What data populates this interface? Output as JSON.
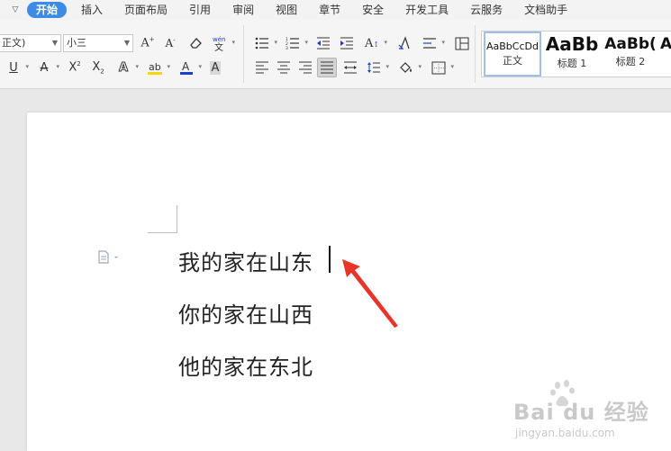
{
  "menu": {
    "items": [
      "开始",
      "插入",
      "页面布局",
      "引用",
      "审阅",
      "视图",
      "章节",
      "安全",
      "开发工具",
      "云服务",
      "文档助手"
    ],
    "active_index": 0
  },
  "ribbon": {
    "font_name": "正文)",
    "font_size": "小三",
    "styles": [
      {
        "sample": "AaBbCcDd",
        "name": "正文"
      },
      {
        "sample": "AaBb",
        "name": "标题 1"
      },
      {
        "sample": "AaBb(",
        "name": "标题 2"
      },
      {
        "sample": "A",
        "name": ""
      }
    ]
  },
  "document": {
    "lines": [
      "我的家在山东",
      "你的家在山西",
      "他的家在东北"
    ]
  },
  "watermark": {
    "brand": "Bai du 经验",
    "url": "jingyan.baidu.com"
  },
  "colors": {
    "active_tab": "#3d8be6",
    "arrow": "#e8352a",
    "highlight": "#f5d800",
    "font_color": "#1c3fd0"
  }
}
